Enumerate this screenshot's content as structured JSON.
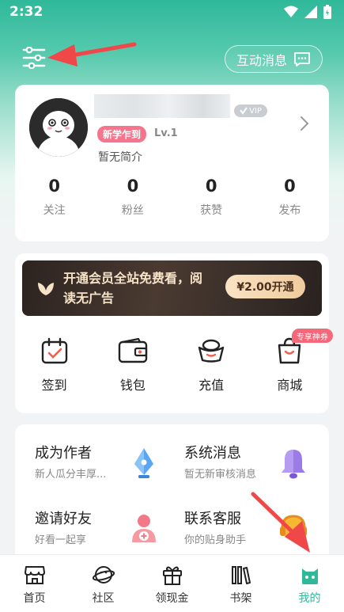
{
  "status_bar": {
    "time": "2:32"
  },
  "header": {
    "message_button_label": "互动消息"
  },
  "profile": {
    "vip_label": "VIP",
    "tag": "新学乍到",
    "level": "Lv.1",
    "bio": "暂无简介",
    "stats": [
      {
        "value": "0",
        "label": "关注"
      },
      {
        "value": "0",
        "label": "粉丝"
      },
      {
        "value": "0",
        "label": "获赞"
      },
      {
        "value": "0",
        "label": "发布"
      }
    ]
  },
  "vip_banner": {
    "text": "开通会员全站免费看，阅读无广告",
    "button_label": "¥2.00开通"
  },
  "quick_actions": [
    {
      "label": "签到",
      "icon": "calendar-check-icon"
    },
    {
      "label": "钱包",
      "icon": "wallet-icon"
    },
    {
      "label": "充值",
      "icon": "gold-ingot-icon"
    },
    {
      "label": "商城",
      "icon": "shopping-bag-icon",
      "badge": "专享神券"
    }
  ],
  "services": [
    {
      "title": "成为作者",
      "subtitle": "新人瓜分丰厚...",
      "icon": "pen-nib-icon"
    },
    {
      "title": "系统消息",
      "subtitle": "暂无新审核消息",
      "icon": "bell-icon"
    },
    {
      "title": "邀请好友",
      "subtitle": "好看一起享",
      "icon": "add-friend-icon"
    },
    {
      "title": "联系客服",
      "subtitle": "你的贴身助手",
      "icon": "headset-icon"
    }
  ],
  "tabbar": {
    "items": [
      {
        "label": "首页",
        "icon": "store-icon"
      },
      {
        "label": "社区",
        "icon": "planet-icon"
      },
      {
        "label": "领现金",
        "icon": "gift-icon"
      },
      {
        "label": "书架",
        "icon": "bookshelf-icon"
      },
      {
        "label": "我的",
        "icon": "profile-mascot-icon",
        "active": true
      }
    ]
  },
  "colors": {
    "accent": "#2fb89a",
    "annotation_arrow": "#f04848",
    "tag": "#f7748c",
    "vip_gold": "#f6e3c7"
  }
}
